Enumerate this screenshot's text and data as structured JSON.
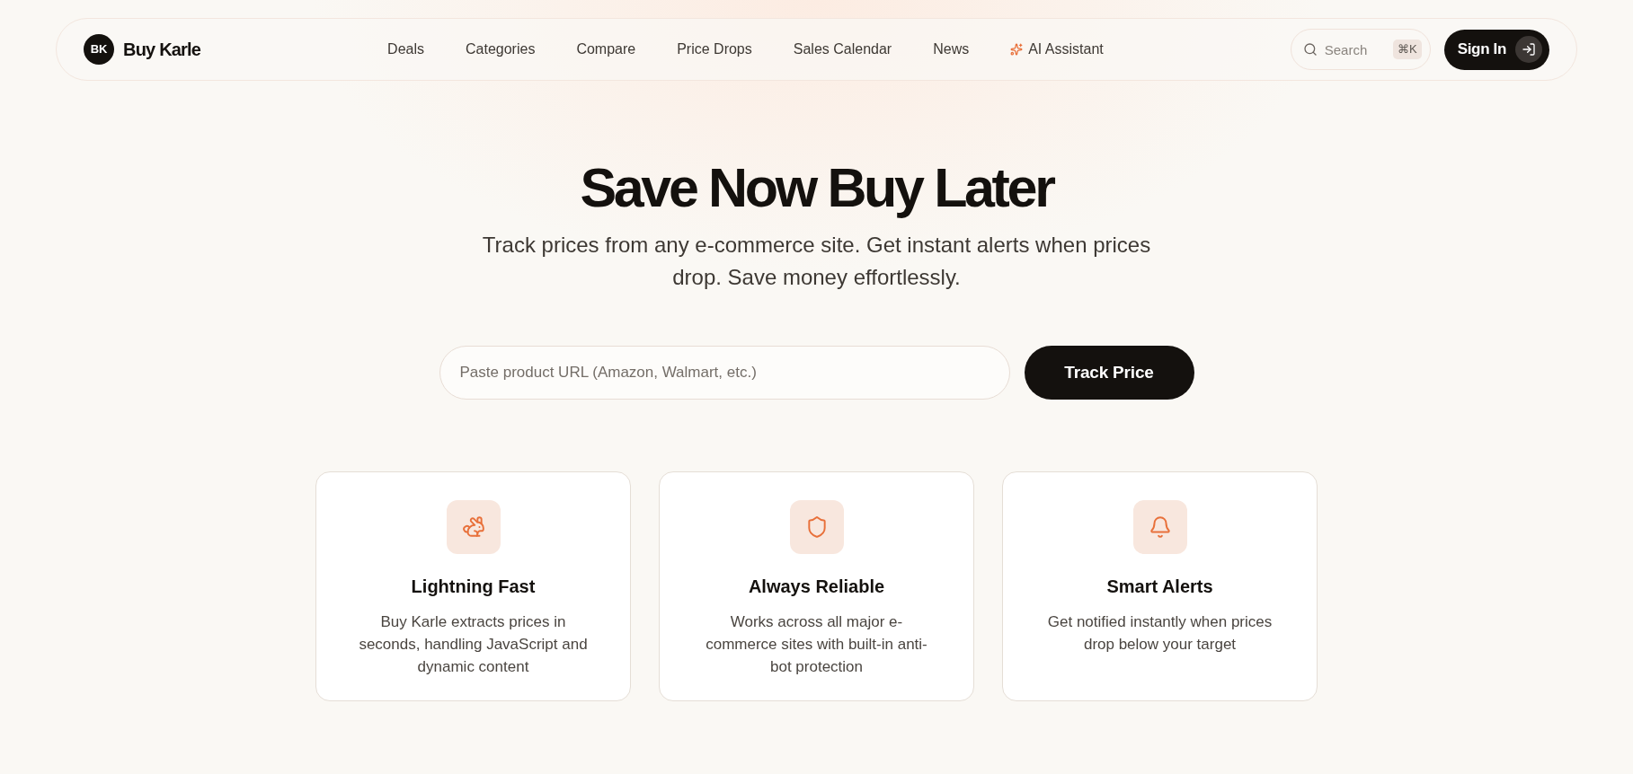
{
  "header": {
    "logo": {
      "initials": "BK",
      "name": "Buy Karle"
    },
    "nav": [
      {
        "label": "Deals",
        "kind": "link"
      },
      {
        "label": "Categories",
        "kind": "link"
      },
      {
        "label": "Compare",
        "kind": "link"
      },
      {
        "label": "Price Drops",
        "kind": "link"
      },
      {
        "label": "Sales Calendar",
        "kind": "link"
      },
      {
        "label": "News",
        "kind": "link"
      },
      {
        "label": "AI Assistant",
        "kind": "ai"
      }
    ],
    "search": {
      "placeholder": "Search",
      "shortcut": "⌘K"
    },
    "sign_in": {
      "label": "Sign In"
    }
  },
  "hero": {
    "title": "Save Now Buy Later",
    "subtitle": "Track prices from any e-commerce site. Get instant alerts when prices drop. Save money effortlessly.",
    "url_input": {
      "placeholder": "Paste product URL (Amazon, Walmart, etc.)"
    },
    "button": "Track Price"
  },
  "features": [
    {
      "title": "Lightning Fast",
      "description": "Buy Karle extracts prices in seconds, handling JavaScript and dynamic content"
    },
    {
      "title": "Always Reliable",
      "description": "Works across all major e-commerce sites with built-in anti-bot protection"
    },
    {
      "title": "Smart Alerts",
      "description": "Get notified instantly when prices drop below your target"
    }
  ]
}
